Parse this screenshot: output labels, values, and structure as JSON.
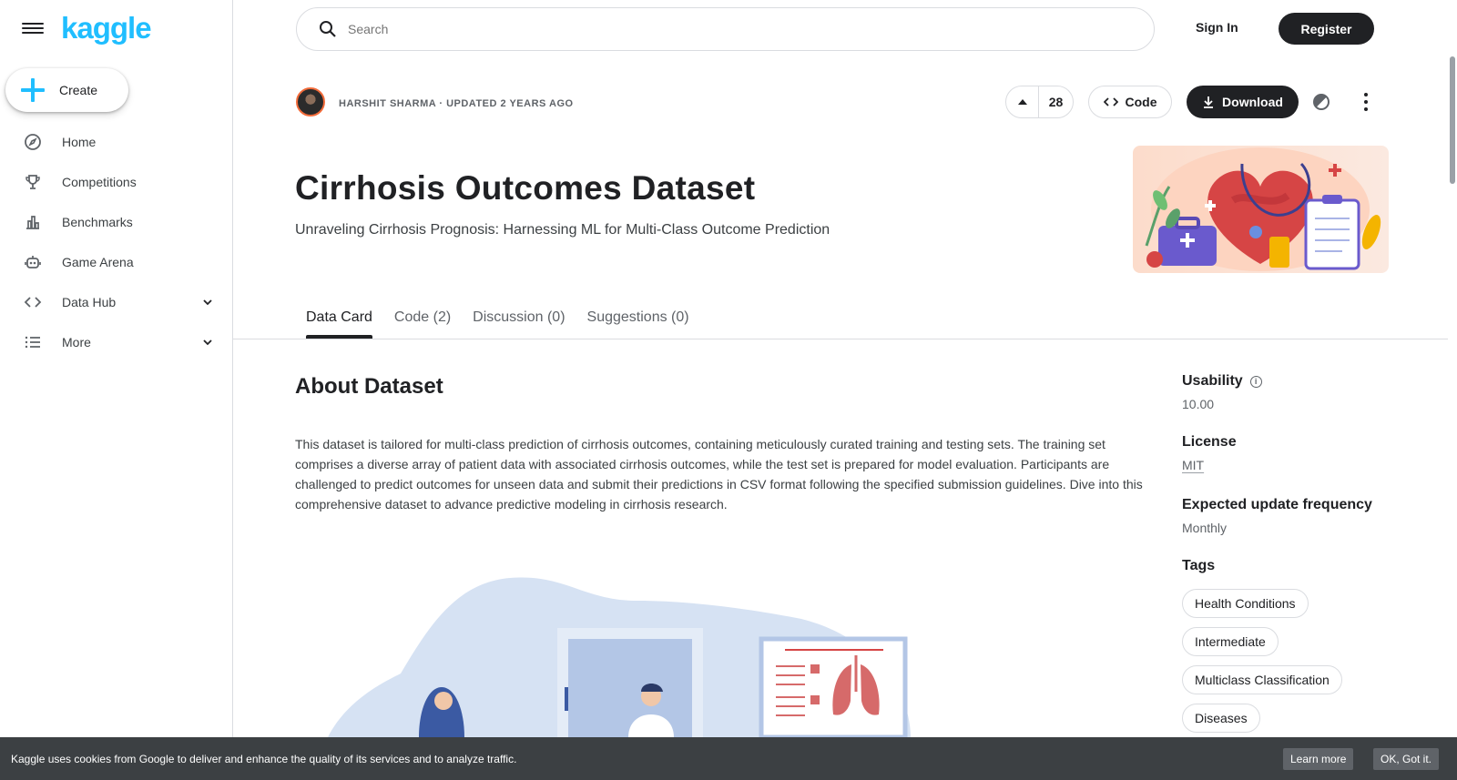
{
  "brand": {
    "logo_text": "kaggle",
    "accent": "#20beff"
  },
  "sidebar": {
    "create_label": "Create",
    "items": [
      {
        "label": "Home",
        "icon": "compass-icon"
      },
      {
        "label": "Competitions",
        "icon": "trophy-icon"
      },
      {
        "label": "Benchmarks",
        "icon": "bar-chart-icon"
      },
      {
        "label": "Game Arena",
        "icon": "robot-icon"
      },
      {
        "label": "Data Hub",
        "icon": "code-icon",
        "expandable": true
      },
      {
        "label": "More",
        "icon": "list-icon",
        "expandable": true
      }
    ]
  },
  "topbar": {
    "search_placeholder": "Search",
    "signin_label": "Sign In",
    "register_label": "Register"
  },
  "dataset": {
    "byline": "HARSHIT SHARMA · UPDATED 2 YEARS AGO",
    "vote_count": "28",
    "code_label": "Code",
    "download_label": "Download",
    "title": "Cirrhosis Outcomes Dataset",
    "subtitle": "Unraveling Cirrhosis Prognosis: Harnessing ML for Multi-Class Outcome Prediction"
  },
  "tabs": [
    {
      "label": "Data Card",
      "active": true
    },
    {
      "label": "Code (2)",
      "active": false
    },
    {
      "label": "Discussion (0)",
      "active": false
    },
    {
      "label": "Suggestions (0)",
      "active": false
    }
  ],
  "about": {
    "heading": "About Dataset",
    "description": "This dataset is tailored for multi-class prediction of cirrhosis outcomes, containing meticulously curated training and testing sets. The training set comprises a diverse array of patient data with associated cirrhosis outcomes, while the test set is prepared for model evaluation. Participants are challenged to predict outcomes for unseen data and submit their predictions in CSV format following the specified submission guidelines. Dive into this comprehensive dataset to advance predictive modeling in cirrhosis research."
  },
  "meta": {
    "usability_label": "Usability",
    "usability_value": "10.00",
    "license_label": "License",
    "license_value": "MIT",
    "frequency_label": "Expected update frequency",
    "frequency_value": "Monthly",
    "tags_label": "Tags",
    "tags": [
      "Health Conditions",
      "Intermediate",
      "Multiclass Classification",
      "Diseases"
    ]
  },
  "cookie": {
    "text": "Kaggle uses cookies from Google to deliver and enhance the quality of its services and to analyze traffic.",
    "learn_label": "Learn more",
    "ok_label": "OK, Got it."
  }
}
